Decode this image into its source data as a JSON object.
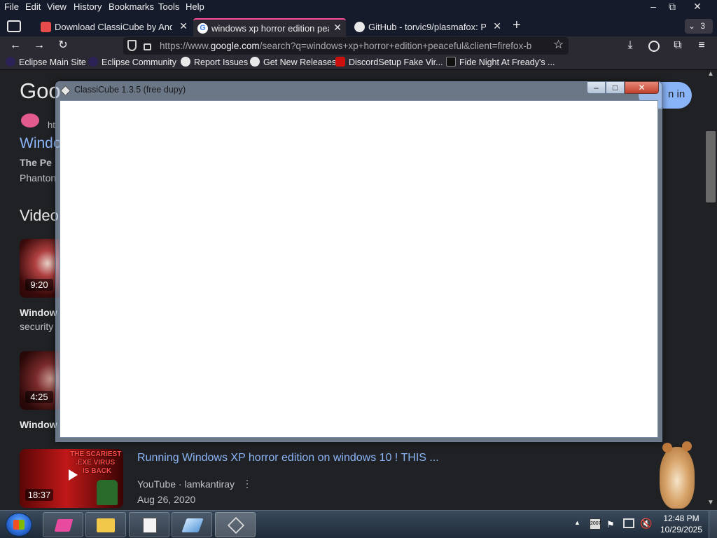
{
  "firefox": {
    "menu": [
      "File",
      "Edit",
      "View",
      "History",
      "Bookmarks",
      "Tools",
      "Help"
    ],
    "window_controls": {
      "minimize": "–",
      "restore": "⧉",
      "close": "✕"
    },
    "tabs": [
      {
        "label": "Download ClassiCube by Andre",
        "active": false,
        "icon": "itch-icon"
      },
      {
        "label": "windows xp horror edition peac",
        "active": true,
        "icon": "google-icon"
      },
      {
        "label": "GitHub - torvic9/plasmafox: Pla",
        "active": false,
        "icon": "github-icon"
      }
    ],
    "new_tab": "+",
    "tab_count": "3",
    "url": {
      "prefix": "https://www.",
      "domain": "google.com",
      "rest": "/search?q=windows+xp+horror+edition+peaceful&client=firefox-b"
    },
    "bookmarks": [
      {
        "label": "Eclipse Main Site",
        "icon": "eclipse-icon"
      },
      {
        "label": "Eclipse Community",
        "icon": "eclipse-icon"
      },
      {
        "label": "Report Issues",
        "icon": "github-icon"
      },
      {
        "label": "Get New Releases",
        "icon": "github-icon"
      },
      {
        "label": "DiscordSetup Fake Vir...",
        "icon": "youtube-icon"
      },
      {
        "label": "Fide Night At Fready's ...",
        "icon": "terminal-icon"
      }
    ]
  },
  "google": {
    "logo": "Goo",
    "sign_in": "n in",
    "result_source": "ht",
    "result_title": "Windo",
    "result_line1": "The Pe",
    "result_line2": "Phanton",
    "videos_heading": "Video",
    "videos": [
      {
        "duration": "9:20",
        "title": "Window",
        "meta": "security"
      },
      {
        "duration": "4:25",
        "title": "Window"
      },
      {
        "duration": "18:37",
        "title": "Running Windows XP horror edition on windows 10 ! THIS ...",
        "channel": "YouTube · lamkantiray",
        "date": "Aug 26, 2020",
        "thumb_text": [
          "THE SCARIEST",
          ".EXE VIRUS",
          "IS BACK"
        ]
      }
    ]
  },
  "classicube": {
    "title": "ClassiCube 1.3.5 (free dupy)",
    "controls": {
      "minimize": "–",
      "maximize": "□",
      "close": "✕"
    }
  },
  "taskbar": {
    "time": "12:48 PM",
    "date": "10/29/2025"
  },
  "colors": {
    "firefox_bg": "#161b2c",
    "toolbar_bg": "#2b2a33",
    "google_bg": "#202124",
    "link_blue": "#8ab4f8",
    "active_tab_accent": "#ff4f9a"
  }
}
